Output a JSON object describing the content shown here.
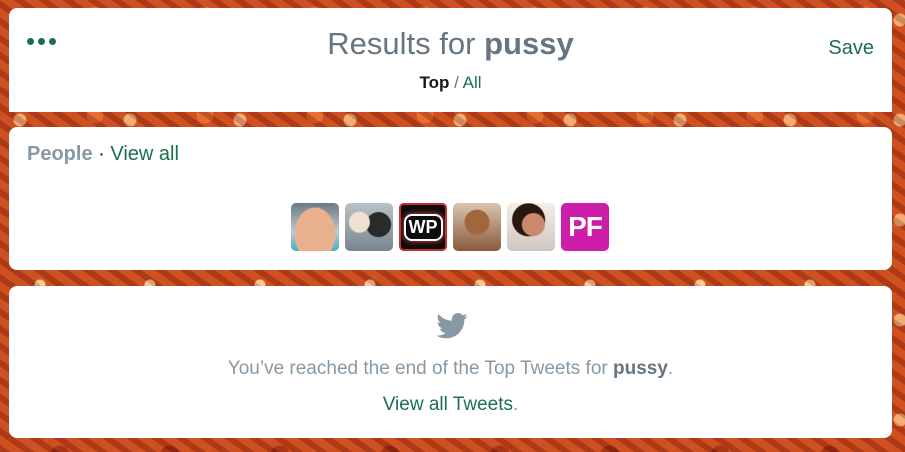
{
  "header": {
    "title_prefix": "Results for",
    "query": "pussy",
    "filter_top": "Top",
    "filter_sep": "/",
    "filter_all": "All",
    "save_label": "Save",
    "more_icon": "more-dots-icon"
  },
  "people": {
    "label": "People",
    "separator": "·",
    "view_all": "View all",
    "avatars": [
      {
        "name": "avatar-1"
      },
      {
        "name": "avatar-2"
      },
      {
        "name": "avatar-3",
        "text": "WP"
      },
      {
        "name": "avatar-4"
      },
      {
        "name": "avatar-5"
      },
      {
        "name": "avatar-6",
        "text": "PF"
      }
    ]
  },
  "end": {
    "icon": "twitter-bird-icon",
    "text_prefix": "You’ve reached the end of the Top Tweets for",
    "query": "pussy",
    "text_suffix": ".",
    "view_all_link": "View all Tweets",
    "view_all_suffix": "."
  },
  "colors": {
    "accent": "#1b6f4a",
    "muted": "#8899a6",
    "title": "#66757f"
  }
}
